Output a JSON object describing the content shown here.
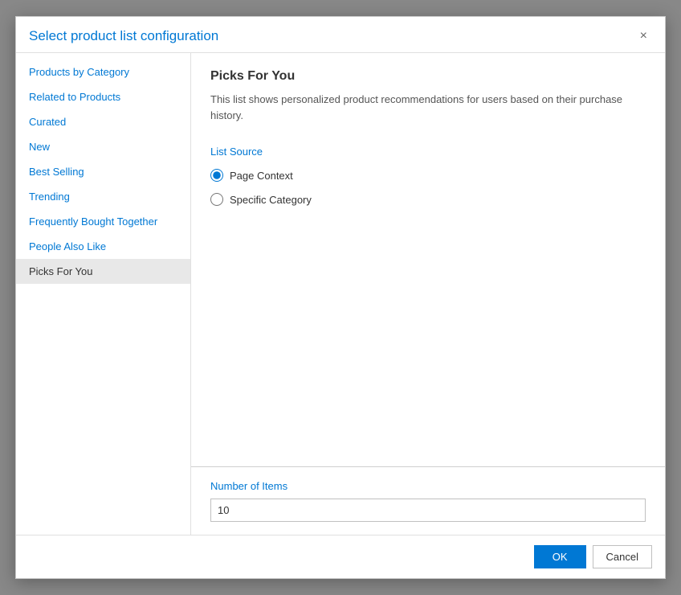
{
  "dialog": {
    "title": "Select product list configuration",
    "close_label": "×"
  },
  "sidebar": {
    "items": [
      {
        "id": "products-by-category",
        "label": "Products by Category",
        "active": false
      },
      {
        "id": "related-to-products",
        "label": "Related to Products",
        "active": false
      },
      {
        "id": "curated",
        "label": "Curated",
        "active": false
      },
      {
        "id": "new",
        "label": "New",
        "active": false
      },
      {
        "id": "best-selling",
        "label": "Best Selling",
        "active": false
      },
      {
        "id": "trending",
        "label": "Trending",
        "active": false
      },
      {
        "id": "frequently-bought-together",
        "label": "Frequently Bought Together",
        "active": false
      },
      {
        "id": "people-also-like",
        "label": "People Also Like",
        "active": false
      },
      {
        "id": "picks-for-you",
        "label": "Picks For You",
        "active": true
      }
    ]
  },
  "main": {
    "title": "Picks For You",
    "description": "This list shows personalized product recommendations for users based on their purchase history.",
    "list_source_label": "List Source",
    "radio_options": [
      {
        "id": "page-context",
        "label": "Page Context",
        "checked": true
      },
      {
        "id": "specific-category",
        "label": "Specific Category",
        "checked": false
      }
    ],
    "number_of_items_label": "Number of Items",
    "number_of_items_value": "10"
  },
  "footer": {
    "ok_label": "OK",
    "cancel_label": "Cancel"
  }
}
